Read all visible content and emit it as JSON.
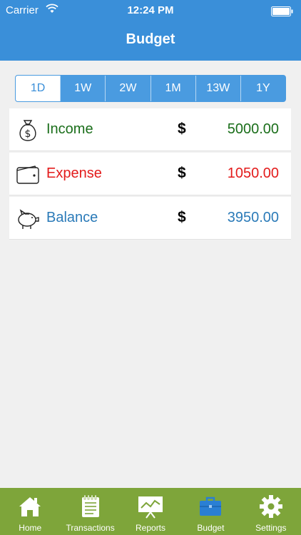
{
  "status": {
    "carrier": "Carrier",
    "time": "12:24 PM"
  },
  "header": {
    "title": "Budget"
  },
  "periods": [
    "1D",
    "1W",
    "2W",
    "1M",
    "13W",
    "1Y"
  ],
  "selected_period": "1D",
  "rows": [
    {
      "label": "Income",
      "currency": "$",
      "amount": "5000.00",
      "color": "#1a6e1a",
      "icon": "money-bag-icon"
    },
    {
      "label": "Expense",
      "currency": "$",
      "amount": "1050.00",
      "color": "#e31b1b",
      "icon": "wallet-icon"
    },
    {
      "label": "Balance",
      "currency": "$",
      "amount": "3950.00",
      "color": "#2a7ab8",
      "icon": "piggy-bank-icon"
    }
  ],
  "tabs": [
    {
      "label": "Home",
      "icon": "home-icon"
    },
    {
      "label": "Transactions",
      "icon": "notepad-icon"
    },
    {
      "label": "Reports",
      "icon": "chart-board-icon"
    },
    {
      "label": "Budget",
      "icon": "briefcase-icon",
      "active": true
    },
    {
      "label": "Settings",
      "icon": "gear-icon"
    }
  ],
  "colors": {
    "header": "#3a8fd9",
    "tabbar": "#7ea53a",
    "active_tab_icon": "#2a7fd4"
  }
}
